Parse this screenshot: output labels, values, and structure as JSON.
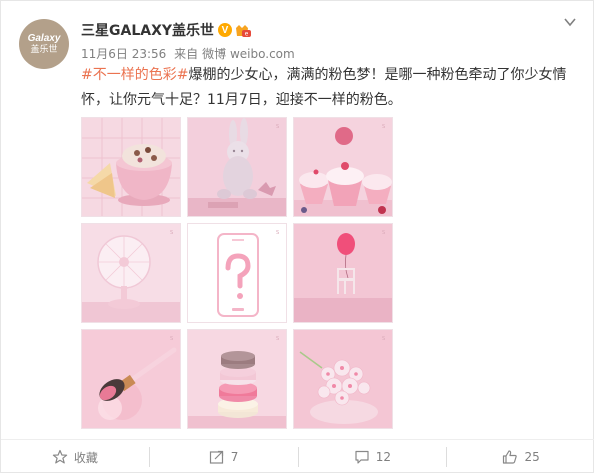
{
  "user": {
    "avatar_line1": "Galaxy",
    "avatar_line2": "盖乐世",
    "name": "三星GALAXY盖乐世",
    "verified_mark": "V"
  },
  "meta": {
    "date": "11月6日 23:56",
    "source_prefix": "来自",
    "source": "微博 weibo.com"
  },
  "post": {
    "hashtag": "#不一样的色彩#",
    "text": "爆棚的少女心，满满的粉色梦！是哪一种粉色牵动了你少女情怀，让你元气十足？11月7日，迎接不一样的粉色。"
  },
  "images": [
    {
      "name": "ice-cream-bowl-image"
    },
    {
      "name": "bunny-toy-image"
    },
    {
      "name": "cupcakes-image"
    },
    {
      "name": "fan-image"
    },
    {
      "name": "phone-question-image"
    },
    {
      "name": "balloon-chair-image"
    },
    {
      "name": "makeup-brush-image"
    },
    {
      "name": "macarons-image"
    },
    {
      "name": "flowers-image"
    }
  ],
  "actions": {
    "favorite_label": "收藏",
    "repost_count": "7",
    "comment_count": "12",
    "like_count": "25"
  },
  "colors": {
    "accent": "#eb7350",
    "verified": "#ffa900",
    "text_gray": "#808080",
    "pink_bg": "#f7d7e1"
  }
}
